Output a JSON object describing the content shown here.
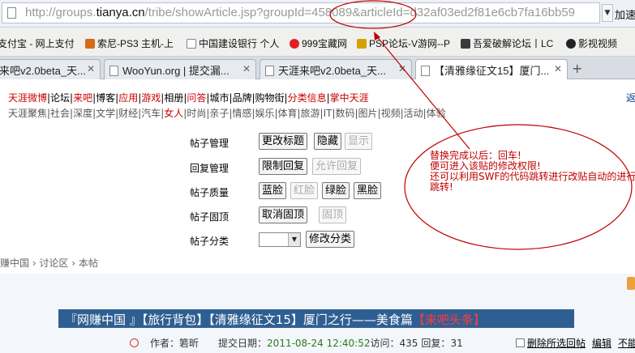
{
  "browser": {
    "url_host": "http://groups.",
    "url_domain": "tianya.cn",
    "url_path": "/tribe/showArticle.jsp?groupId=458089&articleId=d32af03ed2f81e6cb7fa16bb59",
    "right_label": "加速"
  },
  "bookmarks": [
    {
      "label": "支付宝 - 网上支付",
      "color": "#1a6fc9"
    },
    {
      "label": "索尼-PS3 主机-上",
      "color": "#d46a1a"
    },
    {
      "label": "中国建设银行 个人",
      "color": "#ffffff"
    },
    {
      "label": "999宝藏网",
      "color": "#e02020"
    },
    {
      "label": "PSP论坛-V游网--P",
      "color": "#d4a300"
    },
    {
      "label": "吾爱破解论坛丨LC",
      "color": "#3a3a3a"
    },
    {
      "label": "影视视频",
      "color": "#222222"
    }
  ],
  "tabs": [
    {
      "label": "来吧v2.0beta_天..."
    },
    {
      "label": "WooYun.org | 提交漏..."
    },
    {
      "label": "天涯来吧v2.0beta_天..."
    },
    {
      "label": "【清雅缘征文15】厦门..."
    }
  ],
  "nav": {
    "row1_red1": "天涯微博",
    "row1_a": "|论坛|",
    "row1_red2": "来吧",
    "row1_b": "|博客|",
    "row1_red3": "应用",
    "row1_c": "|",
    "row1_red4": "游戏",
    "row1_d": "|相册|",
    "row1_red5": "问答",
    "row1_e": "|城市|品牌|购物街|",
    "row1_red6": "分类信息",
    "row1_f": "|",
    "row1_red7": "掌中天涯",
    "row2_a": "天涯聚焦|社会|深度|文学|财经|汽车|",
    "row2_red": "女人",
    "row2_b": "|时尚|亲子|情感|娱乐|体育|旅游|IT|数码|图片|视频|活动|体验",
    "right": "返"
  },
  "management": {
    "rows": [
      {
        "label": "帖子管理",
        "buttons": [
          "更改标题",
          "隐藏",
          "显示"
        ]
      },
      {
        "label": "回复管理",
        "buttons": [
          "限制回复",
          "允许回复"
        ]
      },
      {
        "label": "帖子质量",
        "buttons": [
          "蓝脸",
          "红脸",
          "绿脸",
          "黑脸"
        ]
      },
      {
        "label": "帖子固顶",
        "buttons": [
          "取消固顶",
          "固顶"
        ]
      },
      {
        "label": "帖子分类",
        "buttons": [
          "修改分类"
        ]
      }
    ]
  },
  "annotation": {
    "line1": "替换完成以后：回车!",
    "line2": "便可进入该贴的修改权限!",
    "line3": "还可以利用SWF的代码跳转进行改贴自动的进行",
    "line4": "跳转!",
    "color": "#c00000"
  },
  "breadcrumb": "赚中国 › 讨论区 › 本帖",
  "post": {
    "title_a": "『网赚中国 』【旅行背包】【清雅缘征文15】厦门之行——美食篇",
    "title_red": "【来吧头条】",
    "author_label": "作者：",
    "author": "箬昕",
    "date_label": "提交日期：",
    "date": "2011-08-24 12:40:52",
    "visits_label": "访问：",
    "visits": "435",
    "replies_label": "回复：",
    "replies": "31",
    "delete_selected": "删除所选回帖",
    "edit": "编辑",
    "last": "不能"
  }
}
